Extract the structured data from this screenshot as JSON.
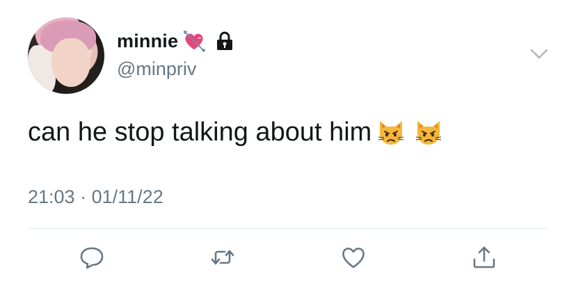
{
  "author": {
    "display_name": "minnie",
    "handle": "@minpriv",
    "badge_icons": [
      "heart-with-arrow-icon",
      "lock-icon"
    ]
  },
  "tweet": {
    "text": "can he stop talking about him",
    "emojis": [
      "pouting-cat-icon",
      "pouting-cat-icon"
    ],
    "time": "21:03",
    "separator": "·",
    "date": "01/11/22"
  },
  "actions": [
    "reply-icon",
    "retweet-icon",
    "like-icon",
    "share-icon"
  ],
  "colors": {
    "text_primary": "#14171a",
    "text_secondary": "#657786",
    "divider": "#e1e8ed",
    "icon": "#657786",
    "heart_pink": "#e8457b"
  }
}
